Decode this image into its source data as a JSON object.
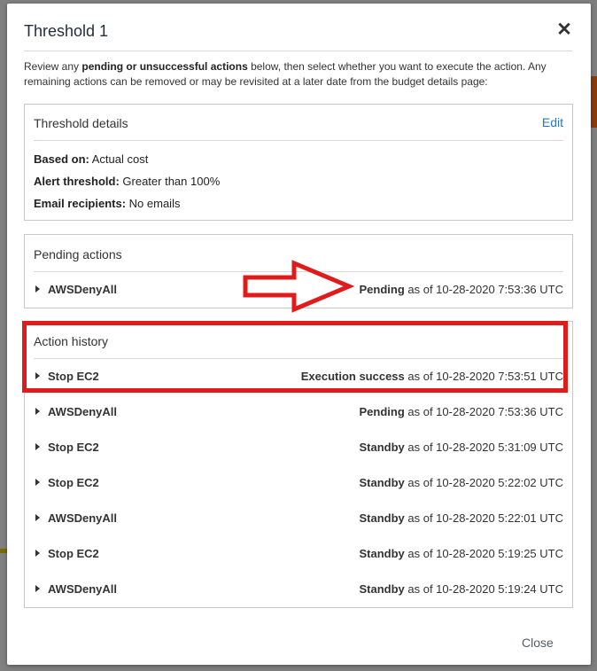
{
  "modal": {
    "title": "Threshold 1",
    "close_icon": "close-icon",
    "intro_prefix": "Review any ",
    "intro_bold": "pending or unsuccessful actions",
    "intro_suffix": " below, then select whether you want to execute the action. Any remaining actions can be removed or may be revisited at a later date from the budget details page:",
    "close_label": "Close"
  },
  "threshold_details": {
    "title": "Threshold details",
    "edit_label": "Edit",
    "based_on_label": "Based on:",
    "based_on_value": " Actual cost",
    "alert_threshold_label": "Alert threshold:",
    "alert_threshold_value": " Greater than 100%",
    "email_recipients_label": "Email recipients:",
    "email_recipients_value": " No emails"
  },
  "pending_actions": {
    "title": "Pending actions",
    "items": [
      {
        "name": "AWSDenyAll",
        "status": "Pending",
        "as_of": " as of 10-28-2020 7:53:36 UTC"
      }
    ]
  },
  "action_history": {
    "title": "Action history",
    "items": [
      {
        "name": "Stop EC2",
        "status": "Execution success",
        "as_of": " as of 10-28-2020 7:53:51 UTC"
      },
      {
        "name": "AWSDenyAll",
        "status": "Pending",
        "as_of": " as of 10-28-2020 7:53:36 UTC"
      },
      {
        "name": "Stop EC2",
        "status": "Standby",
        "as_of": " as of 10-28-2020 5:31:09 UTC"
      },
      {
        "name": "Stop EC2",
        "status": "Standby",
        "as_of": " as of 10-28-2020 5:22:02 UTC"
      },
      {
        "name": "AWSDenyAll",
        "status": "Standby",
        "as_of": " as of 10-28-2020 5:22:01 UTC"
      },
      {
        "name": "Stop EC2",
        "status": "Standby",
        "as_of": " as of 10-28-2020 5:19:25 UTC"
      },
      {
        "name": "AWSDenyAll",
        "status": "Standby",
        "as_of": " as of 10-28-2020 5:19:24 UTC"
      }
    ]
  },
  "colors": {
    "annotation_red": "#e01b1b",
    "link_blue": "#1f79d0"
  }
}
